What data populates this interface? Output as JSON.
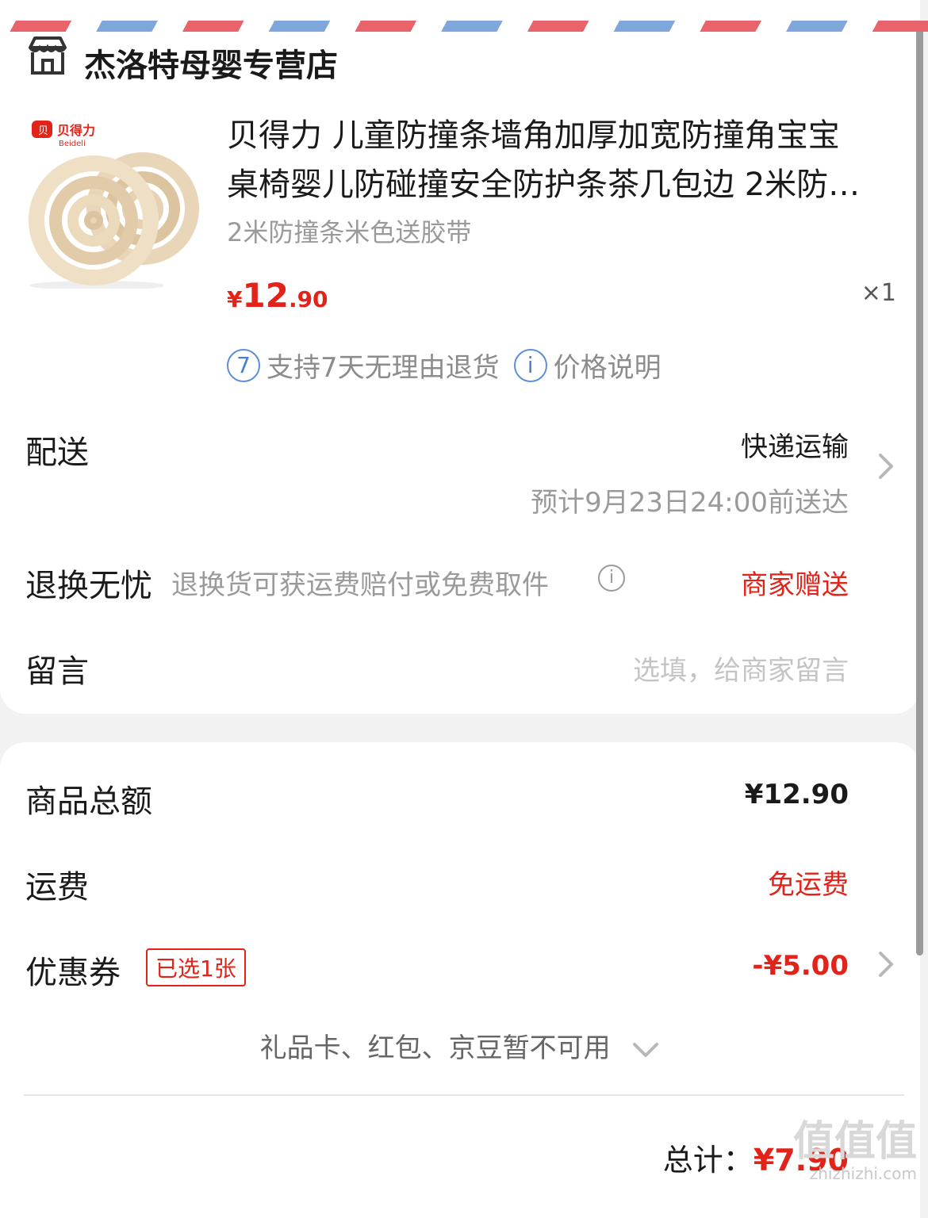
{
  "store": {
    "name": "杰洛特母婴专营店",
    "icon": "store-icon"
  },
  "product": {
    "image_brand": "贝得力",
    "image_brand_en": "Beideli",
    "title_line1": "贝得力 儿童防撞条墙角加厚加宽防撞角宝宝",
    "title_line2": "桌椅婴儿防碰撞安全防护条茶几包边 2米防…",
    "spec": "2米防撞条米色送胶带",
    "price_symbol": "¥",
    "price_int": "12",
    "price_dec": ".90",
    "quantity": "×1",
    "services": [
      {
        "icon": "7",
        "label": "支持7天无理由退货"
      },
      {
        "icon": "i",
        "label": "价格说明"
      }
    ]
  },
  "delivery": {
    "label": "配送",
    "method": "快递运输",
    "eta": "预计9月23日24:00前送达"
  },
  "returns": {
    "label": "退换无忧",
    "desc": "退换货可获运费赔付或免费取件",
    "value": "商家赠送"
  },
  "message": {
    "label": "留言",
    "placeholder": "选填，给商家留言"
  },
  "summary": {
    "goods_total_label": "商品总额",
    "goods_total_value": "¥12.90",
    "shipping_label": "运费",
    "shipping_value": "免运费",
    "coupon_label": "优惠券",
    "coupon_tag": "已选1张",
    "coupon_value": "-¥5.00",
    "unavailable_note": "礼品卡、红包、京豆暂不可用",
    "total_label": "总计：",
    "total_value": "¥7.90"
  },
  "watermark": {
    "text": "值值值",
    "url": "zhizhizhi.com"
  },
  "colors": {
    "accent_red": "#e2231a",
    "info_blue": "#4a80cf",
    "muted": "#9a9a9a"
  }
}
